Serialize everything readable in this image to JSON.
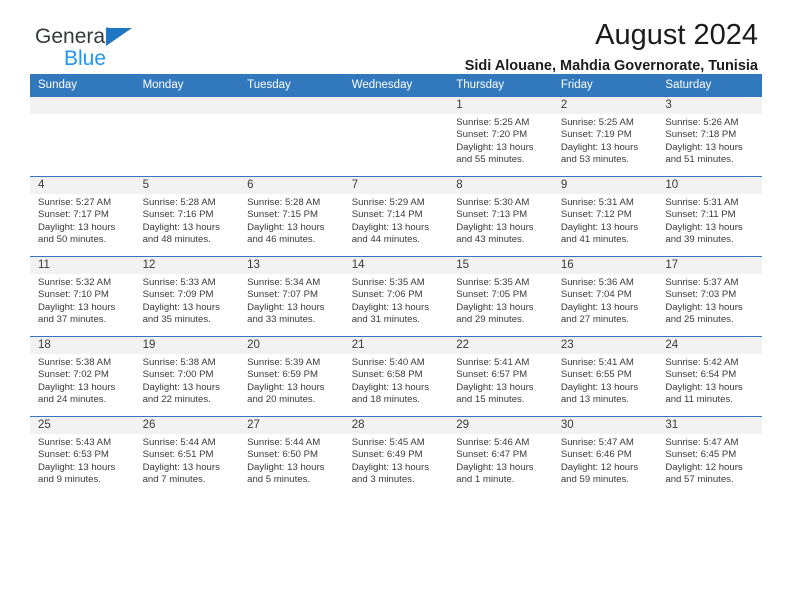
{
  "brand": {
    "name_top": "General",
    "name_bottom": "Blue",
    "triangle_color": "#1f76c2",
    "blue_color": "#2196f3"
  },
  "header": {
    "title": "August 2024",
    "subtitle": "Sidi Alouane, Mahdia Governorate, Tunisia"
  },
  "calendar": {
    "header_bg": "#3278bd",
    "weekdays": [
      "Sunday",
      "Monday",
      "Tuesday",
      "Wednesday",
      "Thursday",
      "Friday",
      "Saturday"
    ],
    "weeks": [
      [
        {
          "day": "",
          "empty": true
        },
        {
          "day": "",
          "empty": true
        },
        {
          "day": "",
          "empty": true
        },
        {
          "day": "",
          "empty": true
        },
        {
          "day": "1",
          "sunrise": "Sunrise: 5:25 AM",
          "sunset": "Sunset: 7:20 PM",
          "daylight_line1": "Daylight: 13 hours",
          "daylight_line2": "and 55 minutes."
        },
        {
          "day": "2",
          "sunrise": "Sunrise: 5:25 AM",
          "sunset": "Sunset: 7:19 PM",
          "daylight_line1": "Daylight: 13 hours",
          "daylight_line2": "and 53 minutes."
        },
        {
          "day": "3",
          "sunrise": "Sunrise: 5:26 AM",
          "sunset": "Sunset: 7:18 PM",
          "daylight_line1": "Daylight: 13 hours",
          "daylight_line2": "and 51 minutes."
        }
      ],
      [
        {
          "day": "4",
          "sunrise": "Sunrise: 5:27 AM",
          "sunset": "Sunset: 7:17 PM",
          "daylight_line1": "Daylight: 13 hours",
          "daylight_line2": "and 50 minutes."
        },
        {
          "day": "5",
          "sunrise": "Sunrise: 5:28 AM",
          "sunset": "Sunset: 7:16 PM",
          "daylight_line1": "Daylight: 13 hours",
          "daylight_line2": "and 48 minutes."
        },
        {
          "day": "6",
          "sunrise": "Sunrise: 5:28 AM",
          "sunset": "Sunset: 7:15 PM",
          "daylight_line1": "Daylight: 13 hours",
          "daylight_line2": "and 46 minutes."
        },
        {
          "day": "7",
          "sunrise": "Sunrise: 5:29 AM",
          "sunset": "Sunset: 7:14 PM",
          "daylight_line1": "Daylight: 13 hours",
          "daylight_line2": "and 44 minutes."
        },
        {
          "day": "8",
          "sunrise": "Sunrise: 5:30 AM",
          "sunset": "Sunset: 7:13 PM",
          "daylight_line1": "Daylight: 13 hours",
          "daylight_line2": "and 43 minutes."
        },
        {
          "day": "9",
          "sunrise": "Sunrise: 5:31 AM",
          "sunset": "Sunset: 7:12 PM",
          "daylight_line1": "Daylight: 13 hours",
          "daylight_line2": "and 41 minutes."
        },
        {
          "day": "10",
          "sunrise": "Sunrise: 5:31 AM",
          "sunset": "Sunset: 7:11 PM",
          "daylight_line1": "Daylight: 13 hours",
          "daylight_line2": "and 39 minutes."
        }
      ],
      [
        {
          "day": "11",
          "sunrise": "Sunrise: 5:32 AM",
          "sunset": "Sunset: 7:10 PM",
          "daylight_line1": "Daylight: 13 hours",
          "daylight_line2": "and 37 minutes."
        },
        {
          "day": "12",
          "sunrise": "Sunrise: 5:33 AM",
          "sunset": "Sunset: 7:09 PM",
          "daylight_line1": "Daylight: 13 hours",
          "daylight_line2": "and 35 minutes."
        },
        {
          "day": "13",
          "sunrise": "Sunrise: 5:34 AM",
          "sunset": "Sunset: 7:07 PM",
          "daylight_line1": "Daylight: 13 hours",
          "daylight_line2": "and 33 minutes."
        },
        {
          "day": "14",
          "sunrise": "Sunrise: 5:35 AM",
          "sunset": "Sunset: 7:06 PM",
          "daylight_line1": "Daylight: 13 hours",
          "daylight_line2": "and 31 minutes."
        },
        {
          "day": "15",
          "sunrise": "Sunrise: 5:35 AM",
          "sunset": "Sunset: 7:05 PM",
          "daylight_line1": "Daylight: 13 hours",
          "daylight_line2": "and 29 minutes."
        },
        {
          "day": "16",
          "sunrise": "Sunrise: 5:36 AM",
          "sunset": "Sunset: 7:04 PM",
          "daylight_line1": "Daylight: 13 hours",
          "daylight_line2": "and 27 minutes."
        },
        {
          "day": "17",
          "sunrise": "Sunrise: 5:37 AM",
          "sunset": "Sunset: 7:03 PM",
          "daylight_line1": "Daylight: 13 hours",
          "daylight_line2": "and 25 minutes."
        }
      ],
      [
        {
          "day": "18",
          "sunrise": "Sunrise: 5:38 AM",
          "sunset": "Sunset: 7:02 PM",
          "daylight_line1": "Daylight: 13 hours",
          "daylight_line2": "and 24 minutes."
        },
        {
          "day": "19",
          "sunrise": "Sunrise: 5:38 AM",
          "sunset": "Sunset: 7:00 PM",
          "daylight_line1": "Daylight: 13 hours",
          "daylight_line2": "and 22 minutes."
        },
        {
          "day": "20",
          "sunrise": "Sunrise: 5:39 AM",
          "sunset": "Sunset: 6:59 PM",
          "daylight_line1": "Daylight: 13 hours",
          "daylight_line2": "and 20 minutes."
        },
        {
          "day": "21",
          "sunrise": "Sunrise: 5:40 AM",
          "sunset": "Sunset: 6:58 PM",
          "daylight_line1": "Daylight: 13 hours",
          "daylight_line2": "and 18 minutes."
        },
        {
          "day": "22",
          "sunrise": "Sunrise: 5:41 AM",
          "sunset": "Sunset: 6:57 PM",
          "daylight_line1": "Daylight: 13 hours",
          "daylight_line2": "and 15 minutes."
        },
        {
          "day": "23",
          "sunrise": "Sunrise: 5:41 AM",
          "sunset": "Sunset: 6:55 PM",
          "daylight_line1": "Daylight: 13 hours",
          "daylight_line2": "and 13 minutes."
        },
        {
          "day": "24",
          "sunrise": "Sunrise: 5:42 AM",
          "sunset": "Sunset: 6:54 PM",
          "daylight_line1": "Daylight: 13 hours",
          "daylight_line2": "and 11 minutes."
        }
      ],
      [
        {
          "day": "25",
          "sunrise": "Sunrise: 5:43 AM",
          "sunset": "Sunset: 6:53 PM",
          "daylight_line1": "Daylight: 13 hours",
          "daylight_line2": "and 9 minutes."
        },
        {
          "day": "26",
          "sunrise": "Sunrise: 5:44 AM",
          "sunset": "Sunset: 6:51 PM",
          "daylight_line1": "Daylight: 13 hours",
          "daylight_line2": "and 7 minutes."
        },
        {
          "day": "27",
          "sunrise": "Sunrise: 5:44 AM",
          "sunset": "Sunset: 6:50 PM",
          "daylight_line1": "Daylight: 13 hours",
          "daylight_line2": "and 5 minutes."
        },
        {
          "day": "28",
          "sunrise": "Sunrise: 5:45 AM",
          "sunset": "Sunset: 6:49 PM",
          "daylight_line1": "Daylight: 13 hours",
          "daylight_line2": "and 3 minutes."
        },
        {
          "day": "29",
          "sunrise": "Sunrise: 5:46 AM",
          "sunset": "Sunset: 6:47 PM",
          "daylight_line1": "Daylight: 13 hours",
          "daylight_line2": "and 1 minute."
        },
        {
          "day": "30",
          "sunrise": "Sunrise: 5:47 AM",
          "sunset": "Sunset: 6:46 PM",
          "daylight_line1": "Daylight: 12 hours",
          "daylight_line2": "and 59 minutes."
        },
        {
          "day": "31",
          "sunrise": "Sunrise: 5:47 AM",
          "sunset": "Sunset: 6:45 PM",
          "daylight_line1": "Daylight: 12 hours",
          "daylight_line2": "and 57 minutes."
        }
      ]
    ]
  }
}
